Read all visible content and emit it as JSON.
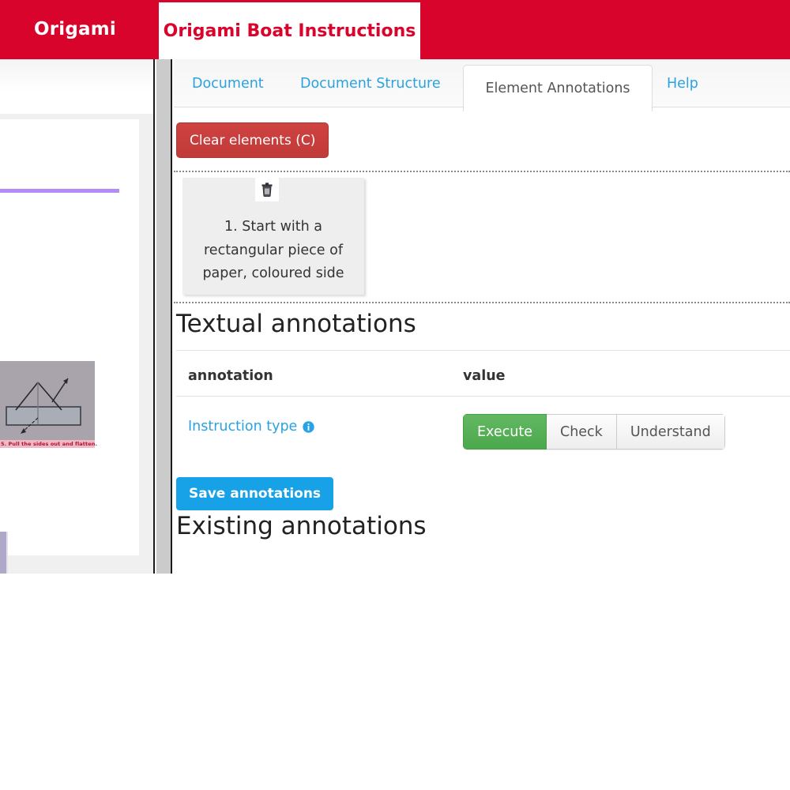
{
  "navbar": {
    "brand": "Origami",
    "document_tab": "Origami Boat Instructions"
  },
  "left_document_pane": {
    "figure_caption": "5. Pull the sides out and flatten.",
    "highlight_colors": {
      "line_highlight": "#b38cf5",
      "block_highlight": "#b0a8c8",
      "caption_highlight": "#efb9c6"
    },
    "figure_icon": "origami-fold-diagram"
  },
  "right_pane": {
    "tabs": [
      {
        "label": "Document",
        "active": false
      },
      {
        "label": "Document Structure",
        "active": false
      },
      {
        "label": "Element Annotations",
        "active": true
      },
      {
        "label": "Help",
        "active": false
      }
    ],
    "clear_button": {
      "label": "Clear elements (C)",
      "color": "#c03b39"
    },
    "element_card": {
      "delete_icon": "trash-icon",
      "text": "1. Start with a rectangular piece of paper, coloured side"
    },
    "textual_annotations": {
      "title": "Textual annotations",
      "columns": [
        "annotation",
        "value"
      ],
      "rows": [
        {
          "label": "Instruction type",
          "info_icon": "info-circle-icon",
          "options": [
            "Execute",
            "Check",
            "Understand"
          ],
          "selected": "Execute",
          "selected_color": "#5cb85c"
        }
      ]
    },
    "save_button": {
      "label": "Save annotations",
      "color": "#17a2e8"
    },
    "existing_annotations": {
      "title": "Existing annotations"
    }
  },
  "theme": {
    "navbar_red": "#d9042b",
    "link_blue": "#29a3e0"
  }
}
